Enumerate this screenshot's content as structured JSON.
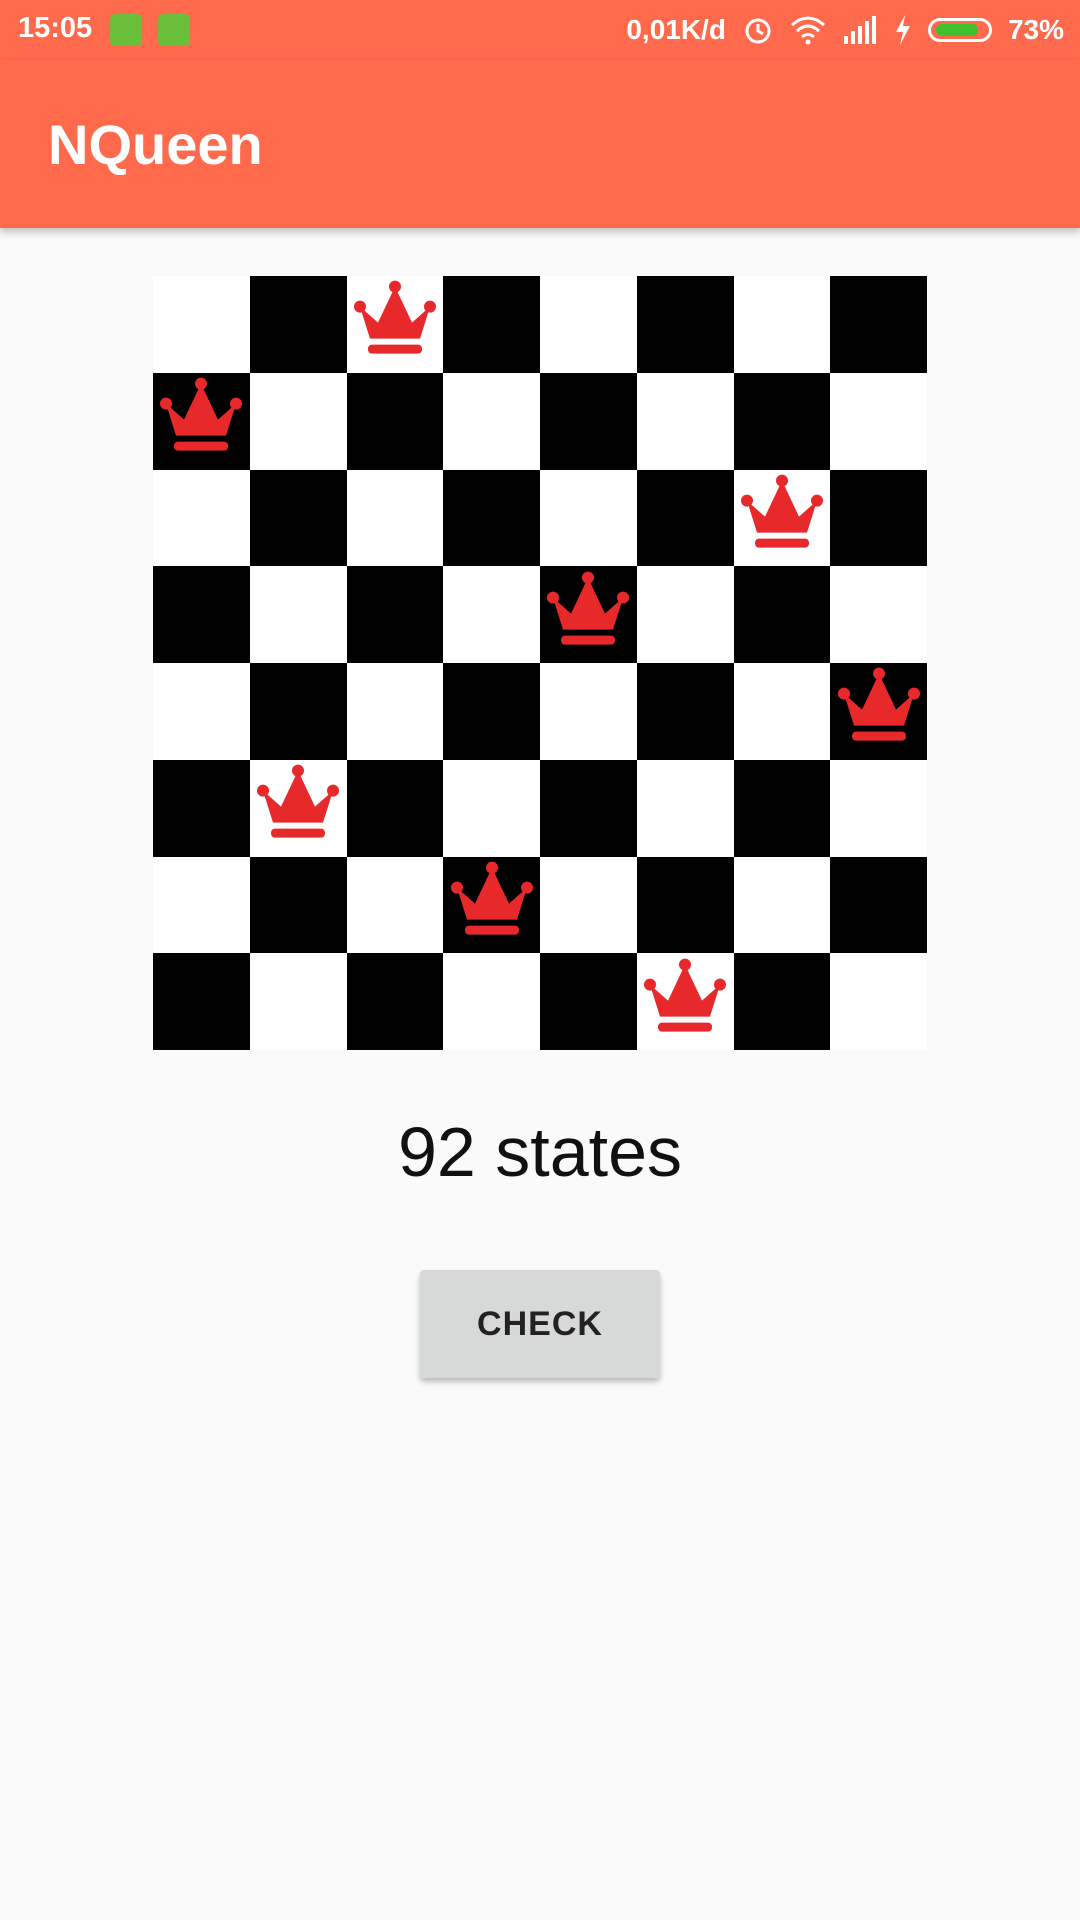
{
  "status_bar": {
    "time": "15:05",
    "speed": "0,01K/d",
    "battery": "73%"
  },
  "app_bar": {
    "title": "NQueen"
  },
  "board": {
    "size": 8,
    "queen_columns_by_row": [
      2,
      0,
      6,
      4,
      7,
      1,
      3,
      5
    ],
    "colors": {
      "dark": "#000000",
      "light": "#ffffff",
      "queen": "#e8292c"
    }
  },
  "status_text": "92 states",
  "check_button": {
    "label": "CHECK"
  },
  "colors": {
    "primary": "#ff6a4d",
    "background": "#fafafa",
    "button": "#d7d8d8"
  }
}
